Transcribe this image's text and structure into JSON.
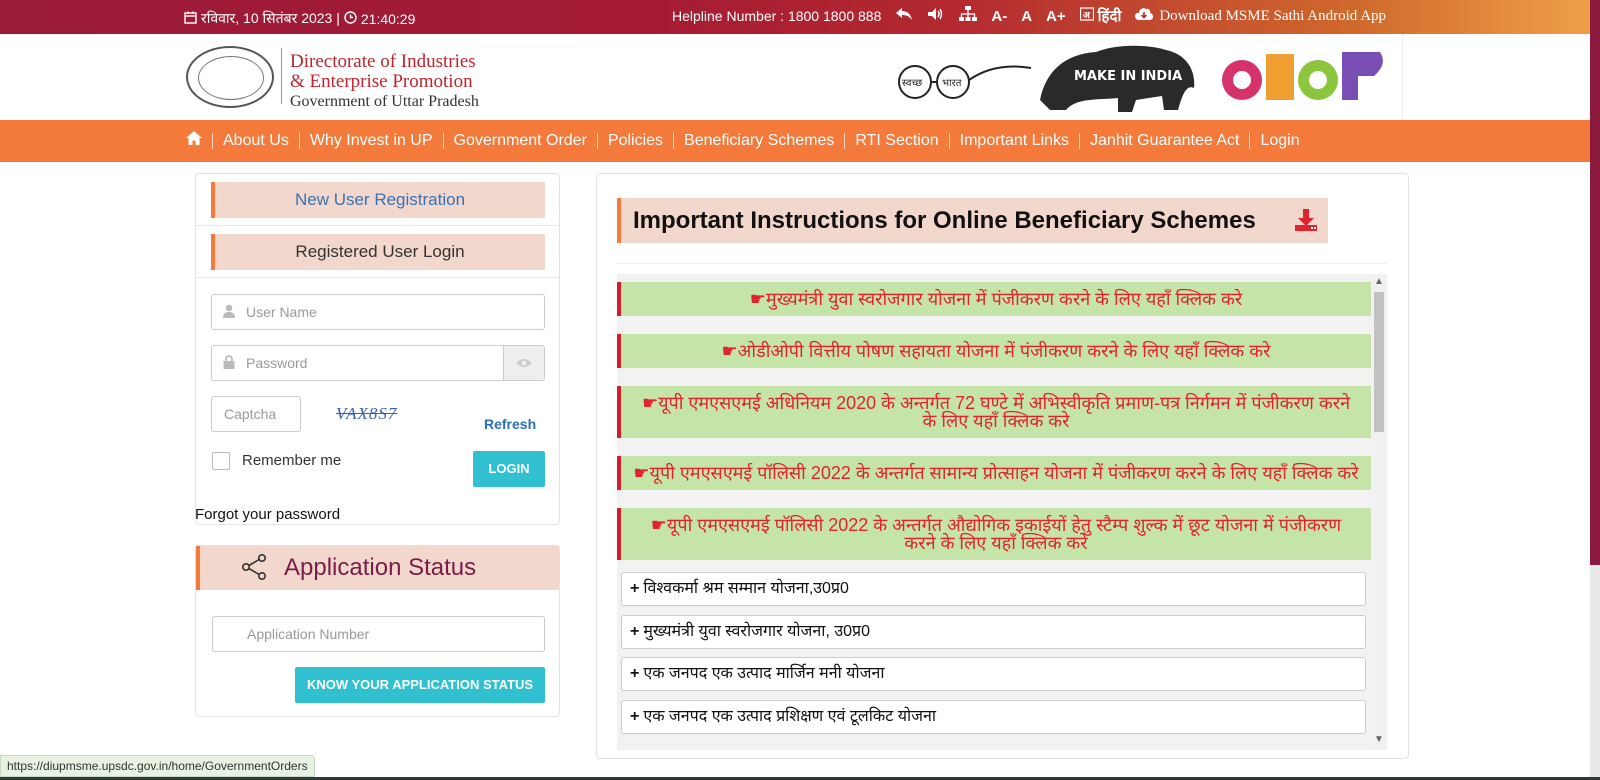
{
  "topbar": {
    "date": "रविवार, 10 सितंबर 2023 |",
    "time": "21:40:29",
    "helpline": "Helpline Number : 1800 1800 888",
    "font_minus": "A-",
    "font_normal": "A",
    "font_plus": "A+",
    "language": "हिंदी",
    "download": "Download MSME Sathi Android App"
  },
  "header": {
    "org_line1": "Directorate of Industries",
    "org_line2": "& Enterprise Promotion",
    "org_line3": "Government of Uttar Pradesh",
    "swachh_left": "स्वच्छ",
    "swachh_right": "भारत",
    "make_in_india": "MAKE IN INDIA"
  },
  "nav": {
    "items": [
      {
        "label": "About Us"
      },
      {
        "label": "Why Invest in UP"
      },
      {
        "label": "Government Order"
      },
      {
        "label": "Policies"
      },
      {
        "label": "Beneficiary Schemes"
      },
      {
        "label": "RTI Section"
      },
      {
        "label": "Important Links"
      },
      {
        "label": "Janhit Guarantee Act"
      },
      {
        "label": "Login"
      }
    ]
  },
  "login": {
    "new_user": "New User Registration",
    "registered": "Registered User Login",
    "username_placeholder": "User Name",
    "password_placeholder": "Password",
    "captcha_placeholder": "Captcha",
    "captcha_text": "VAX8S7",
    "refresh": "Refresh",
    "remember": "Remember me",
    "login_button": "LOGIN",
    "forgot": "Forgot your password"
  },
  "status": {
    "title": "Application Status",
    "app_placeholder": "Application Number",
    "button": "KNOW YOUR APPLICATION STATUS"
  },
  "content": {
    "title": "Important Instructions for Online Beneficiary Schemes",
    "links": [
      "☛मुख्यमंत्री युवा स्वरोजगार योजना में पंजीकरण करने के लिए यहाँ क्लिक करे",
      "☛ओडीओपी वित्तीय पोषण सहायता योजना में पंजीकरण करने के लिए यहाँ क्लिक करे",
      "☛यूपी एमएसएमई अधिनियम 2020 के अन्तर्गत 72 घण्टे में अभिस्वीकृति प्रमाण-पत्र निर्गमन में पंजीकरण करने के लिए यहाँ क्लिक करे",
      "☛यूपी एमएसएमई पॉलिसी 2022 के अन्तर्गत सामान्य प्रोत्साहन योजना में पंजीकरण करने के लिए यहाँ क्लिक करे",
      "☛यूपी एमएसएमई पॉलिसी 2022 के अन्तर्गत औद्योगिक इकाईयों हेतु स्टैम्प शुल्क में छूट योजना में पंजीकरण करने के लिए यहाँ क्लिक करे"
    ],
    "accordion": [
      "विश्वकर्मा श्रम सम्मान योजना,उ0प्र0",
      "मुख्यमंत्री युवा स्वरोजगार योजना, उ0प्र0",
      "एक जनपद एक उत्पाद मार्जिन मनी योजना",
      "एक जनपद एक उत्पाद प्रशिक्षण एवं टूलकिट योजना"
    ]
  },
  "statusbar": {
    "url": "https://diupmsme.upsdc.gov.in/home/GovernmentOrders"
  },
  "colors": {
    "nav_orange": "#f47a3c",
    "accent_teal": "#30c0d0",
    "link_red": "#e0232e",
    "link_bg": "#c5e4a8",
    "title_bg": "#f1d7cc"
  }
}
